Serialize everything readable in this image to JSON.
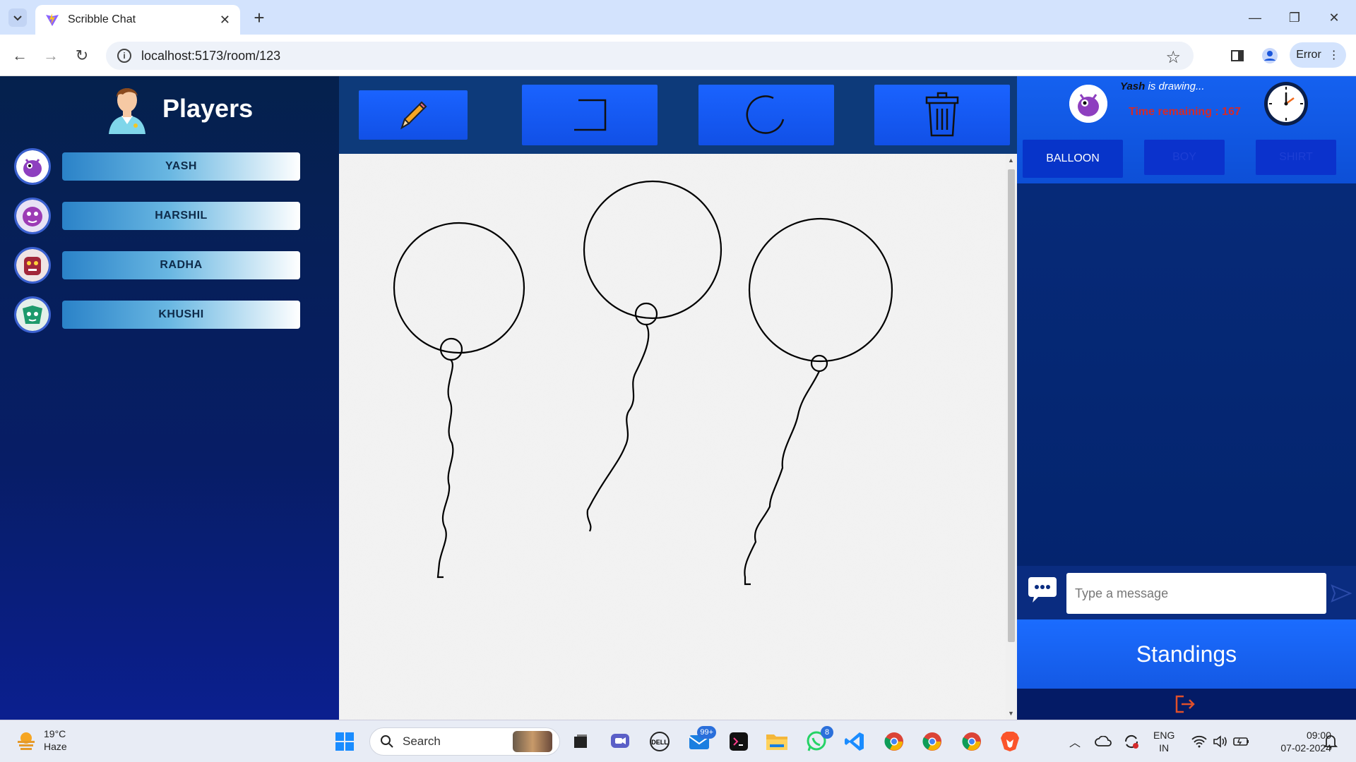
{
  "browser": {
    "tab_title": "Scribble Chat",
    "url": "localhost:5173/room/123",
    "profile_status": "Error"
  },
  "sidebar": {
    "title": "Players",
    "players": [
      {
        "name": "YASH",
        "avatar_color": "#8e3fbf"
      },
      {
        "name": "HARSHIL",
        "avatar_color": "#9c3bb5"
      },
      {
        "name": "RADHA",
        "avatar_color": "#a2263a"
      },
      {
        "name": "KHUSHI",
        "avatar_color": "#1d9a6c"
      }
    ]
  },
  "toolbar": {
    "tools": [
      "pencil-icon",
      "rectangle-icon",
      "circle-icon",
      "trash-icon"
    ]
  },
  "game": {
    "drawer_name": "Yash",
    "drawing_suffix": " is drawing...",
    "time_label": "Time remaining : 167",
    "time_remaining": 167,
    "word_choices": [
      {
        "label": "BALLOON",
        "selected": true
      },
      {
        "label": "BOY",
        "selected": false
      },
      {
        "label": "SHIRT",
        "selected": false
      }
    ]
  },
  "chat": {
    "placeholder": "Type a message",
    "value": ""
  },
  "standings_label": "Standings",
  "taskbar": {
    "temperature": "19°C",
    "condition": "Haze",
    "search_label": "Search",
    "mail_badge": "99+",
    "whatsapp_badge": "8",
    "lang_line1": "ENG",
    "lang_line2": "IN",
    "time": "09:00",
    "date": "07-02-2024"
  },
  "colors": {
    "accent_blue": "#1561f0",
    "sidebar_navy": "#071d66",
    "timer_red": "#d42a2a"
  }
}
